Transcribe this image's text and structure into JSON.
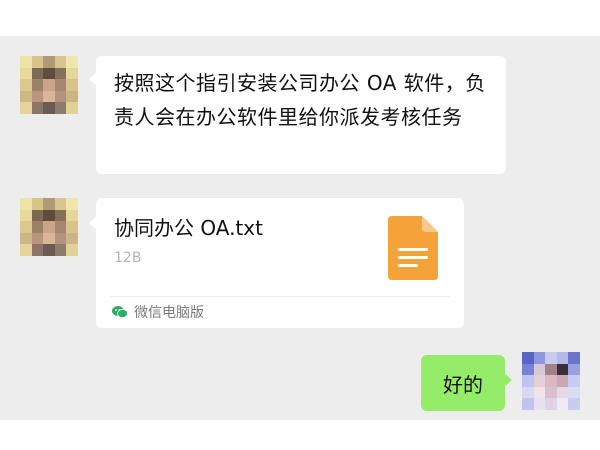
{
  "conversation": {
    "message1": {
      "text": "按照这个指引安装公司办公 OA 软件，负责人会在办公软件里给你派发考核任务"
    },
    "file_message": {
      "file_name": "协同办公 OA.txt",
      "file_size": "12B",
      "file_icon": "document-icon",
      "source_label": "微信电脑版",
      "source_icon": "wechat-icon"
    },
    "reply": {
      "text": "好的"
    }
  },
  "colors": {
    "chat_background": "#ededed",
    "incoming_bubble": "#ffffff",
    "outgoing_bubble": "#95ec69",
    "file_icon": "#f4a23a",
    "wechat_green": "#2aae67"
  }
}
